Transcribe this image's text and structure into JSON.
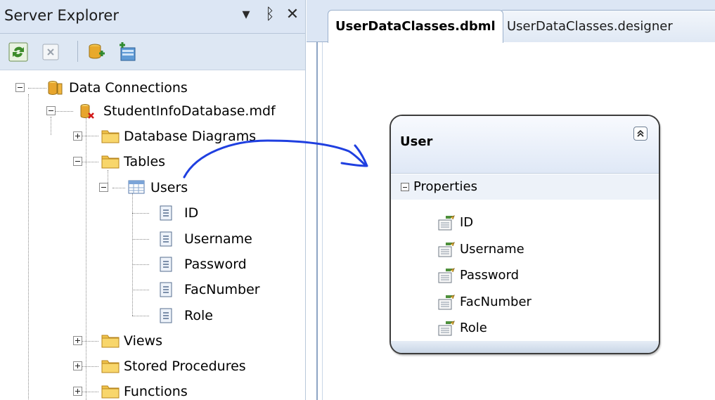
{
  "server_explorer": {
    "title": "Server Explorer",
    "controls": {
      "dropdown": "▾",
      "pin": "ᛒ",
      "close": "✕"
    },
    "toolbar": {
      "buttons": [
        {
          "icon": "refresh-icon"
        },
        {
          "icon": "stop-icon"
        },
        {
          "icon": "connect-to-database-icon"
        },
        {
          "icon": "connect-to-server-icon"
        }
      ]
    },
    "tree": {
      "data_connections": "Data Connections",
      "database": "StudentInfoDatabase.mdf",
      "database_diagrams": "Database Diagrams",
      "tables": "Tables",
      "users_table": "Users",
      "columns": [
        "ID",
        "Username",
        "Password",
        "FacNumber",
        "Role"
      ],
      "views": "Views",
      "stored_procedures": "Stored Procedures",
      "functions": "Functions"
    }
  },
  "designer": {
    "tabs": [
      {
        "label": "UserDataClasses.dbml",
        "active": true
      },
      {
        "label": "UserDataClasses.designer",
        "active": false
      }
    ],
    "entity": {
      "title": "User",
      "section": "Properties",
      "properties": [
        "ID",
        "Username",
        "Password",
        "FacNumber",
        "Role"
      ]
    }
  },
  "colors": {
    "annotation_arrow": "#1f3fe0",
    "folder": "#f0c34b",
    "database": "#e7a52d"
  }
}
